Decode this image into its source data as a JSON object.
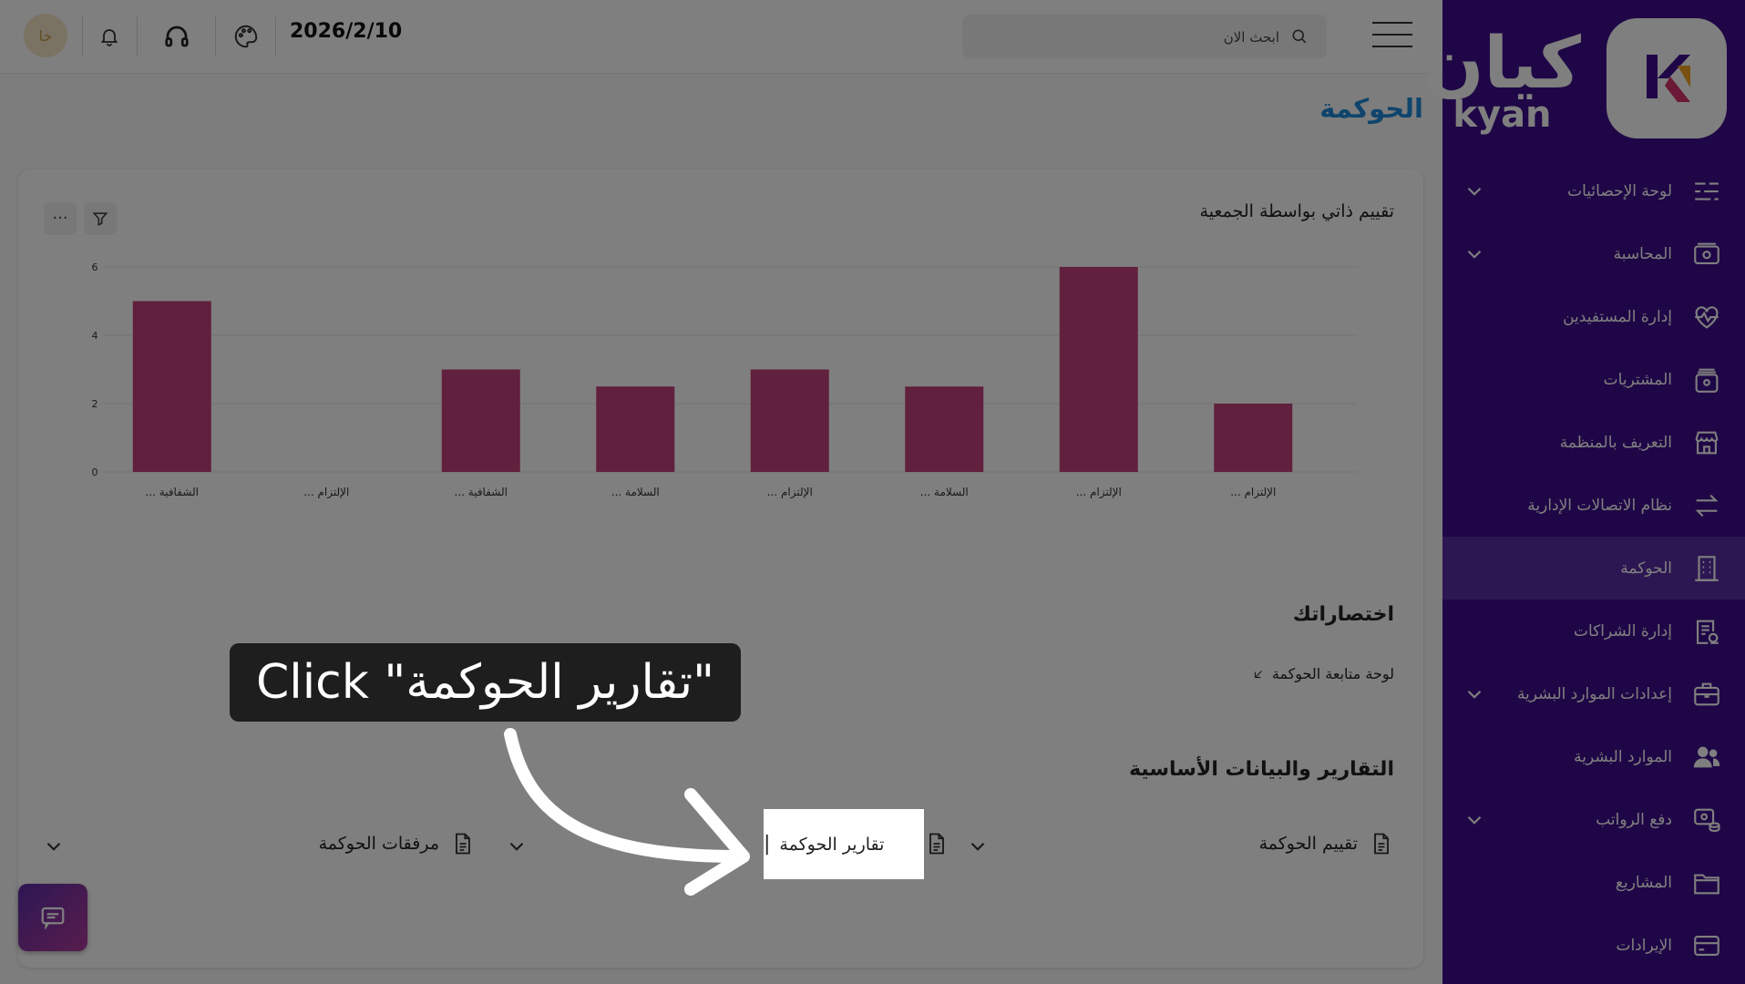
{
  "topbar": {
    "avatar_initials": "خا",
    "date": "2026/2/10",
    "search_placeholder": "ابحث الان"
  },
  "brand": {
    "name_ar": "كيان",
    "name_en": "kyan"
  },
  "sidebar": {
    "items": [
      {
        "label": "لوحة الإحصائيات",
        "icon": "sliders-icon",
        "expandable": true
      },
      {
        "label": "المحاسبة",
        "icon": "money-icon",
        "expandable": true
      },
      {
        "label": "إدارة المستفيدين",
        "icon": "heart-pulse-icon",
        "expandable": false
      },
      {
        "label": "المشتريات",
        "icon": "bag-icon",
        "expandable": false
      },
      {
        "label": "التعريف بالمنظمة",
        "icon": "store-icon",
        "expandable": false
      },
      {
        "label": "نظام الاتصالات الإدارية",
        "icon": "arrows-exchange-icon",
        "expandable": false
      },
      {
        "label": "الحوكمة",
        "icon": "building-icon",
        "expandable": false,
        "active": true
      },
      {
        "label": "إدارة الشراكات",
        "icon": "contract-icon",
        "expandable": false
      },
      {
        "label": "إعدادات الموارد البشرية",
        "icon": "briefcase-icon",
        "expandable": true
      },
      {
        "label": "الموارد البشرية",
        "icon": "users-icon",
        "expandable": false
      },
      {
        "label": "دفع الرواتب",
        "icon": "payroll-icon",
        "expandable": true
      },
      {
        "label": "المشاريع",
        "icon": "folder-icon",
        "expandable": false
      },
      {
        "label": "الإيرادات",
        "icon": "card-icon",
        "expandable": false
      }
    ]
  },
  "main": {
    "page_title": "الحوكمة",
    "chart_title": "تقييم ذاتي بواسطة الجمعية",
    "shortcuts_title": "اختصاراتك",
    "shortcut_link": "لوحة متابعة الحوكمة",
    "reports_title": "التقارير والبيانات الأساسية",
    "reports": [
      {
        "label": "تقييم الحوكمة"
      },
      {
        "label": "تقارير الحوكمة"
      },
      {
        "label": "مرفقات الحوكمة"
      }
    ]
  },
  "overlay": {
    "instruction": "Click \"تقارير الحوكمة\"",
    "target": "تقارير الحوكمة"
  },
  "colors": {
    "sidebar_bg": "#3f0f8f",
    "sidebar_active": "#5a2ea6",
    "title_blue": "#1f8ad8",
    "bar_color": "#c2407a"
  },
  "chart_data": {
    "type": "bar",
    "categories": [
      "... الشفافية",
      "... الإلتزام",
      "... الشفافية",
      "... السلامة",
      "... الإلتزام",
      "... السلامة",
      "... الإلتزام",
      "... الإلتزام"
    ],
    "values": [
      5,
      0,
      3,
      2.5,
      3,
      2.5,
      6,
      2
    ],
    "y_ticks": [
      0,
      2,
      4,
      6
    ],
    "ylim": [
      0,
      6
    ],
    "grid": true
  }
}
